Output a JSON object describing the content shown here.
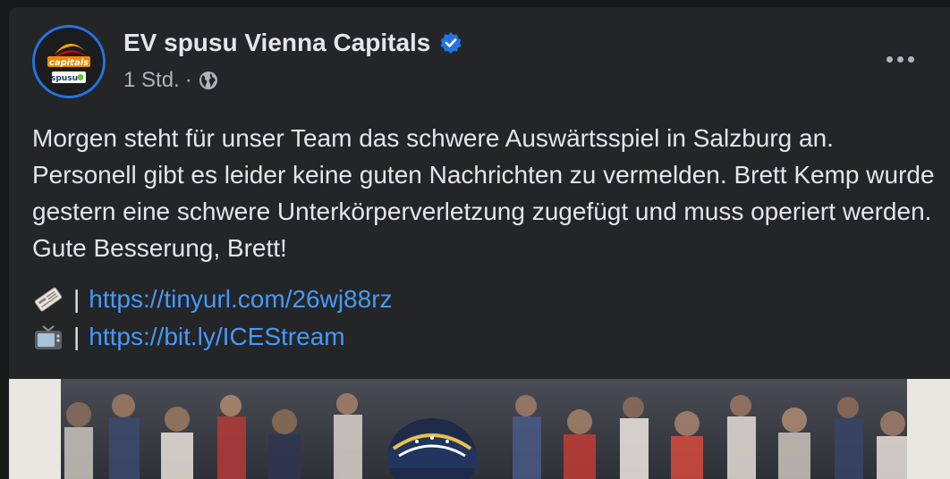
{
  "post": {
    "page_name": "EV spusu Vienna Capitals",
    "timestamp": "1 Std.",
    "meta_separator": "·",
    "avatar_logo_text": "capitals",
    "avatar_sponsor_text": "spusu",
    "text": "Morgen steht für unser Team das schwere Auswärtsspiel in Salzburg an. Personell gibt es leider keine guten Nachrichten zu vermelden. Brett Kemp wurde gestern eine schwere Unterkörperverletzung zugefügt und muss operiert werden. Gute Besserung, Brett!",
    "links": [
      {
        "icon": "newspaper-icon",
        "separator": "|",
        "url": "https://tinyurl.com/26wj88rz"
      },
      {
        "icon": "television-icon",
        "separator": "|",
        "url": "https://bit.ly/ICEStream"
      }
    ]
  },
  "colors": {
    "background": "#18191a",
    "card": "#242526",
    "text": "#e4e6eb",
    "secondary_text": "#b0b3b8",
    "link": "#4599ff",
    "verified_badge": "#2374e1"
  }
}
